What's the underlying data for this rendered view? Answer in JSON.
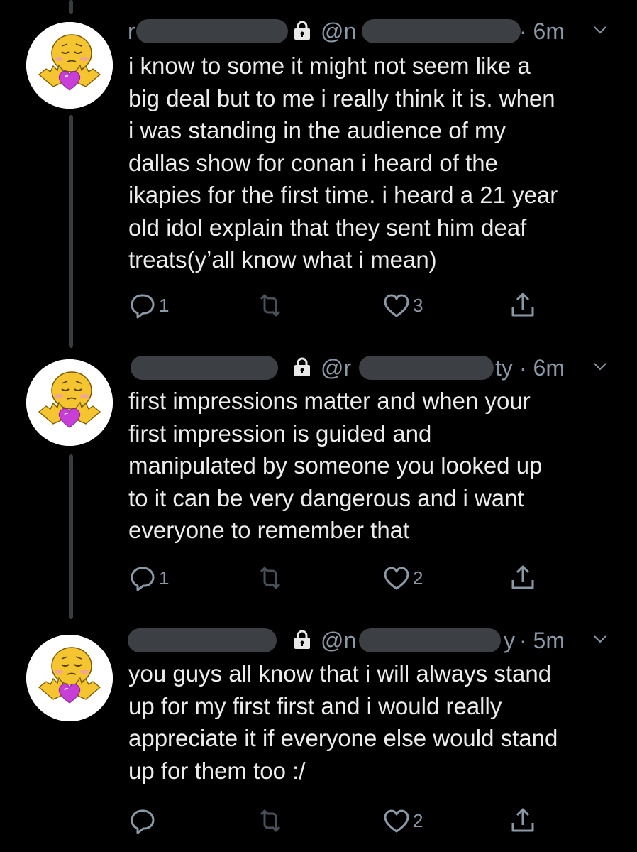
{
  "tweets": [
    {
      "name_prefix": "r",
      "handle_prefix": "@n",
      "handle_suffix": "",
      "time": "· 6m",
      "lines": [
        "i know to some it might not seem like a",
        "big deal but to me i really think it is. when",
        "i was standing in the audience of my",
        "dallas show for conan i heard of the",
        "ikapies for the first time. i heard a 21 year",
        "old idol explain that they sent him deaf",
        "treats(y’all know what i mean)"
      ],
      "reply_count": "1",
      "retweet_count": "",
      "like_count": "3"
    },
    {
      "name_prefix": "",
      "handle_prefix": "@r",
      "handle_suffix": "ty",
      "time": "· 6m",
      "lines": [
        "first impressions matter and when your",
        "first impression is guided and",
        "manipulated by someone you looked up",
        "to it can be very dangerous and i want",
        "everyone to remember that"
      ],
      "reply_count": "1",
      "retweet_count": "",
      "like_count": "2"
    },
    {
      "name_prefix": "",
      "handle_prefix": "@n",
      "handle_suffix": "y",
      "time": "· 5m",
      "lines": [
        "you guys all know that i will always stand",
        "up for my first first and i would really",
        "appreciate it if everyone else would stand",
        "up for them too :/"
      ],
      "reply_count": "",
      "retweet_count": "",
      "like_count": "2"
    }
  ],
  "colors": {
    "background": "#000000",
    "text": "#ececec",
    "muted": "#8b98a5",
    "redaction": "#3c3f43",
    "thread_line": "#3a3d40"
  },
  "icons": [
    "lock-icon",
    "chevron-down-icon",
    "reply-icon",
    "retweet-icon",
    "like-icon",
    "share-icon"
  ]
}
